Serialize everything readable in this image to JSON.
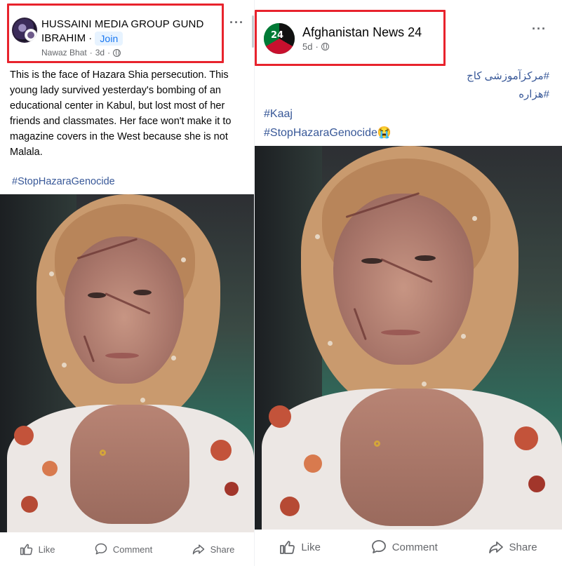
{
  "left_post": {
    "group_name_line1": "HUSSAINI  MEDIA GROUP GUND",
    "group_name_line2": "IBRAHIM",
    "separator": "·",
    "join_label": "Join",
    "author": "Nawaz Bhat",
    "age": "3d",
    "more_label": "···",
    "body_lines": [
      "This is the face of Hazara Shia persecution. This",
      "young lady survived yesterday's bombing of an",
      "educational center in Kabul, but lost most of her",
      "friends and classmates. Her face won't make it to",
      "magazine covers in the West because she is not",
      "Malala."
    ],
    "hashtag": "#StopHazaraGenocide",
    "actions": {
      "like": "Like",
      "comment": "Comment",
      "share": "Share"
    }
  },
  "right_post": {
    "page_name": "Afghanistan News 24",
    "avatar_text": "24",
    "age": "5d",
    "separator": "·",
    "more_label": "···",
    "hashtags_rtl": [
      "#مرکزآموزشی کاج",
      "#هزاره"
    ],
    "hashtags": [
      "#Kaaj",
      "#StopHazaraGenocide😭"
    ],
    "actions": {
      "like": "Like",
      "comment": "Comment",
      "share": "Share"
    }
  },
  "colors": {
    "highlight": "#e8232d",
    "hashtag": "#385898",
    "join_bg": "#e7f3ff",
    "join_text": "#1877f2",
    "meta": "#65676b"
  },
  "icons": [
    "globe-icon",
    "more-icon",
    "like-icon",
    "comment-icon",
    "share-icon"
  ]
}
